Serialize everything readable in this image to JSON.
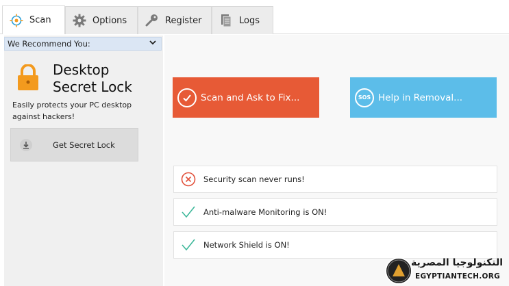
{
  "tabs": [
    {
      "label": "Scan",
      "icon": "target-icon",
      "active": true
    },
    {
      "label": "Options",
      "icon": "gear-icon",
      "active": false
    },
    {
      "label": "Register",
      "icon": "key-icon",
      "active": false
    },
    {
      "label": "Logs",
      "icon": "document-icon",
      "active": false
    }
  ],
  "sidebar": {
    "header": "We Recommend You:",
    "product_line1": "Desktop",
    "product_line2": "Secret Lock",
    "description_line1": "Easily protects your PC desktop",
    "description_line2": "against hackers!",
    "get_button": "Get Secret Lock"
  },
  "main": {
    "scan_fix_label": "Scan and Ask to Fix...",
    "help_removal_label": "Help in Removal...",
    "help_icon_text": "SOS",
    "statuses": [
      {
        "text": "Security scan never runs!",
        "state": "error"
      },
      {
        "text": "Anti-malware Monitoring is ON!",
        "state": "ok"
      },
      {
        "text": "Network Shield is ON!",
        "state": "ok"
      }
    ]
  },
  "colors": {
    "scan_button": "#e75a36",
    "help_button": "#5cbde9",
    "ok": "#3db89a",
    "error": "#e2513b",
    "lock": "#f39a1e"
  },
  "watermark": {
    "arabic": "التكنولوجيا المصرية",
    "english": "EGYPTIANTECH.ORG"
  }
}
